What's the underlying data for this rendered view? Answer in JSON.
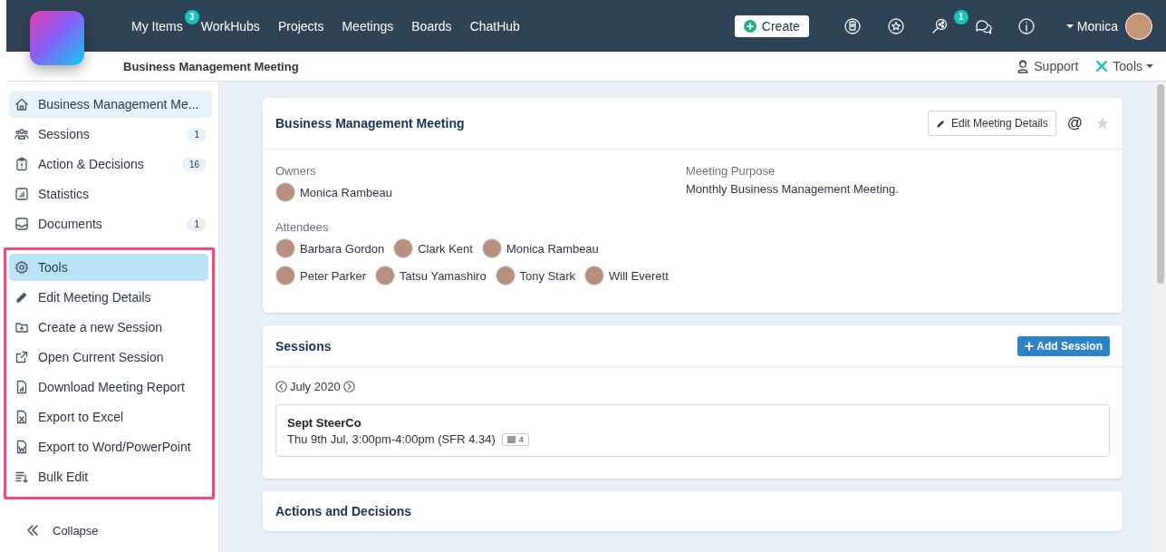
{
  "topbar": {
    "nav": [
      {
        "label": "My Items",
        "badge": "3"
      },
      {
        "label": "WorkHubs"
      },
      {
        "label": "Projects"
      },
      {
        "label": "Meetings"
      },
      {
        "label": "Boards"
      },
      {
        "label": "ChatHub"
      }
    ],
    "create_label": "Create",
    "chat_badge": "1",
    "user": "Monica"
  },
  "subheader": {
    "title": "Business Management Meeting",
    "support": "Support",
    "tools": "Tools"
  },
  "sidebar": {
    "nav_items": [
      {
        "label": "Business Management Me...",
        "selected": true
      },
      {
        "label": "Sessions",
        "badge": "1",
        "selected": false
      },
      {
        "label": "Action & Decisions",
        "badge": "16",
        "selected": false
      },
      {
        "label": "Statistics",
        "selected": false
      },
      {
        "label": "Documents",
        "badge": "1",
        "selected": false
      }
    ],
    "tools_menu": {
      "label": "Tools",
      "expanded": true,
      "items": [
        "Edit Meeting Details",
        "Create a new Session",
        "Open Current Session",
        "Download Meeting Report",
        "Export to Excel",
        "Export to Word/PowerPoint",
        "Bulk Edit"
      ]
    },
    "collapse": "Collapse"
  },
  "meeting_card": {
    "title": "Business Management Meeting",
    "edit_button": "Edit Meeting Details",
    "at_sign": "@",
    "favorite": false,
    "owners_label": "Owners",
    "owners": [
      "Monica Rambeau"
    ],
    "purpose_label": "Meeting Purpose",
    "purpose": "Monthly Business Management Meeting.",
    "attendees_label": "Attendees",
    "attendees": [
      "Barbara Gordon",
      "Clark Kent",
      "Monica Rambeau",
      "Peter Parker",
      "Tatsu Yamashiro",
      "Tony Stark",
      "Will Everett"
    ]
  },
  "sessions_card": {
    "title": "Sessions",
    "add_button": "Add Session",
    "month": "July 2020",
    "sessions": [
      {
        "name": "Sept SteerCo",
        "time": "Thu 9th Jul, 3:00pm-4:00pm (SFR 4.34)",
        "items": "4"
      }
    ]
  },
  "actions_card": {
    "title": "Actions and Decisions"
  }
}
